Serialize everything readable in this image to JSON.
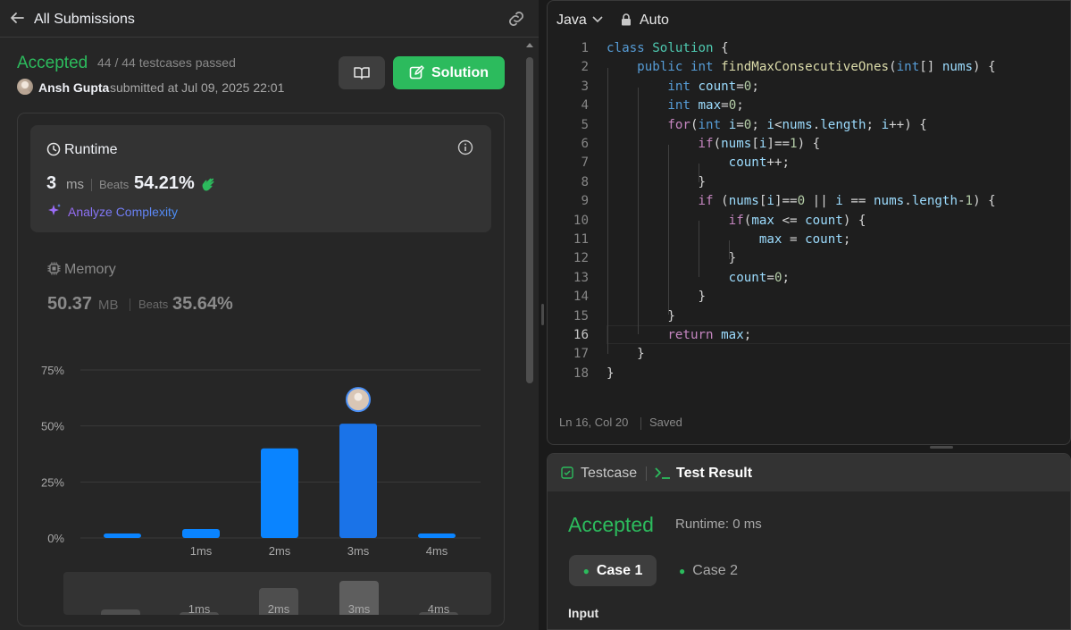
{
  "left_panel": {
    "header_title": "All Submissions",
    "status": "Accepted",
    "testcases_passed": "44 / 44 testcases passed",
    "submitter": "Ansh Gupta",
    "submitted_at": "submitted at Jul 09, 2025 22:01",
    "solution_button": "Solution",
    "runtime": {
      "label": "Runtime",
      "value": "3",
      "unit": "ms",
      "beats_label": "Beats",
      "beats_value": "54.21%",
      "analyze": "Analyze Complexity"
    },
    "memory": {
      "label": "Memory",
      "value": "50.37",
      "unit": "MB",
      "beats_label": "Beats",
      "beats_value": "35.64%"
    }
  },
  "chart_data": {
    "type": "bar",
    "categories": [
      "",
      "1ms",
      "2ms",
      "3ms",
      "4ms"
    ],
    "values": [
      2,
      4,
      40,
      51,
      2
    ],
    "highlight_index": 3,
    "y_ticks": [
      "0%",
      "25%",
      "50%",
      "75%"
    ],
    "ylim": [
      0,
      75
    ],
    "grid": true,
    "colors": {
      "bar": "#0a84ff",
      "highlight": "#1a73e8",
      "grid": "#3a3a3a"
    }
  },
  "mini_chart": {
    "labels": [
      "",
      "1ms",
      "2ms",
      "3ms",
      "4ms"
    ],
    "values": [
      6,
      3,
      30,
      38,
      3
    ]
  },
  "editor": {
    "language": "Java",
    "mode": "Auto",
    "cursor": "Ln 16, Col 20",
    "saved": "Saved"
  },
  "results": {
    "tab_testcase": "Testcase",
    "tab_result": "Test Result",
    "status": "Accepted",
    "runtime": "Runtime: 0 ms",
    "case_1": "Case 1",
    "case_2": "Case 2",
    "input_label": "Input"
  },
  "colors": {
    "accepted": "#2cbb5d",
    "panel": "#262626",
    "editor": "#1e1e1e"
  }
}
